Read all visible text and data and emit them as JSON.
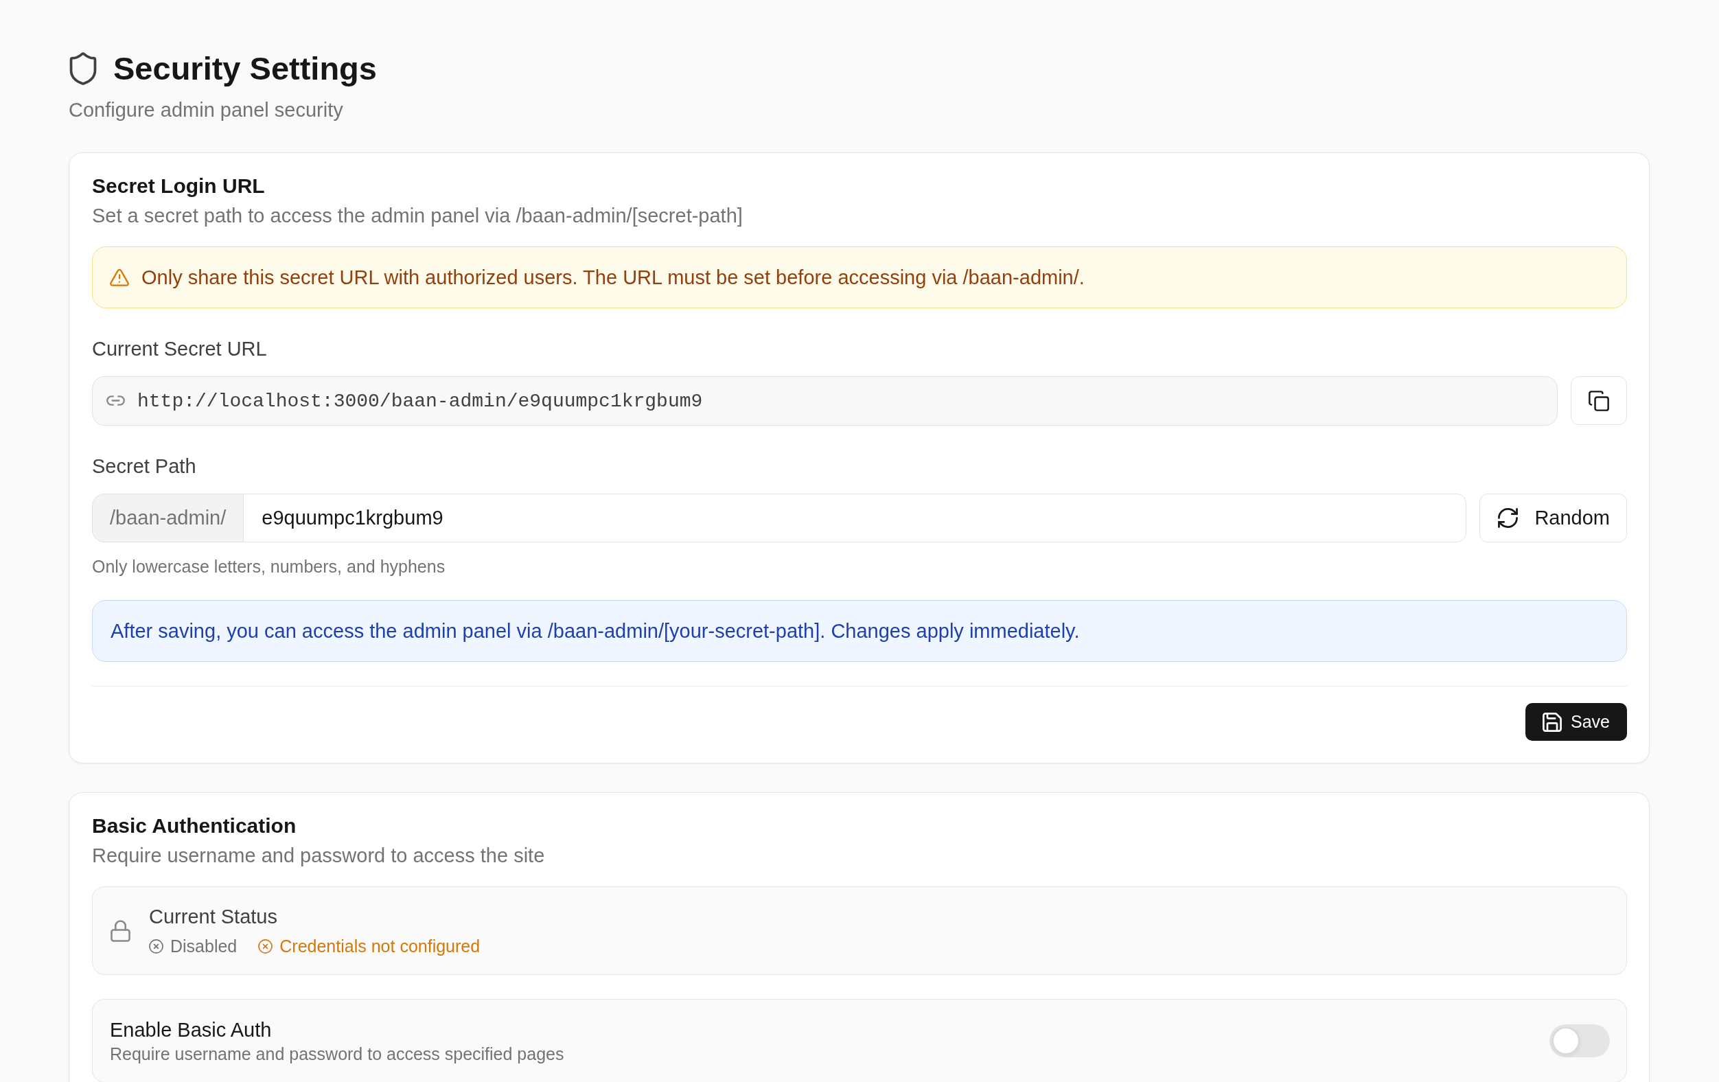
{
  "header": {
    "title": "Security Settings",
    "subtitle": "Configure admin panel security"
  },
  "secret_login_url": {
    "title": "Secret Login URL",
    "description": "Set a secret path to access the admin panel via /baan-admin/[secret-path]",
    "warning": "Only share this secret URL with authorized users. The URL must be set before accessing via /baan-admin/.",
    "current_url": {
      "label": "Current Secret URL",
      "value": "http://localhost:3000/baan-admin/e9quumpc1krgbum9"
    },
    "secret_path": {
      "label": "Secret Path",
      "prefix": "/baan-admin/",
      "value": "e9quumpc1krgbum9",
      "hint": "Only lowercase letters, numbers, and hyphens",
      "random_button": "Random"
    },
    "info": "After saving, you can access the admin panel via /baan-admin/[your-secret-path]. Changes apply immediately.",
    "save_button": "Save"
  },
  "basic_authentication": {
    "title": "Basic Authentication",
    "description": "Require username and password to access the site",
    "status": {
      "label": "Current Status",
      "items": [
        {
          "text": "Disabled",
          "color": "#737373"
        },
        {
          "text": "Credentials not configured",
          "color": "#d97706"
        }
      ]
    },
    "enable": {
      "label": "Enable Basic Auth",
      "description": "Require username and password to access specified pages",
      "on": false
    }
  }
}
